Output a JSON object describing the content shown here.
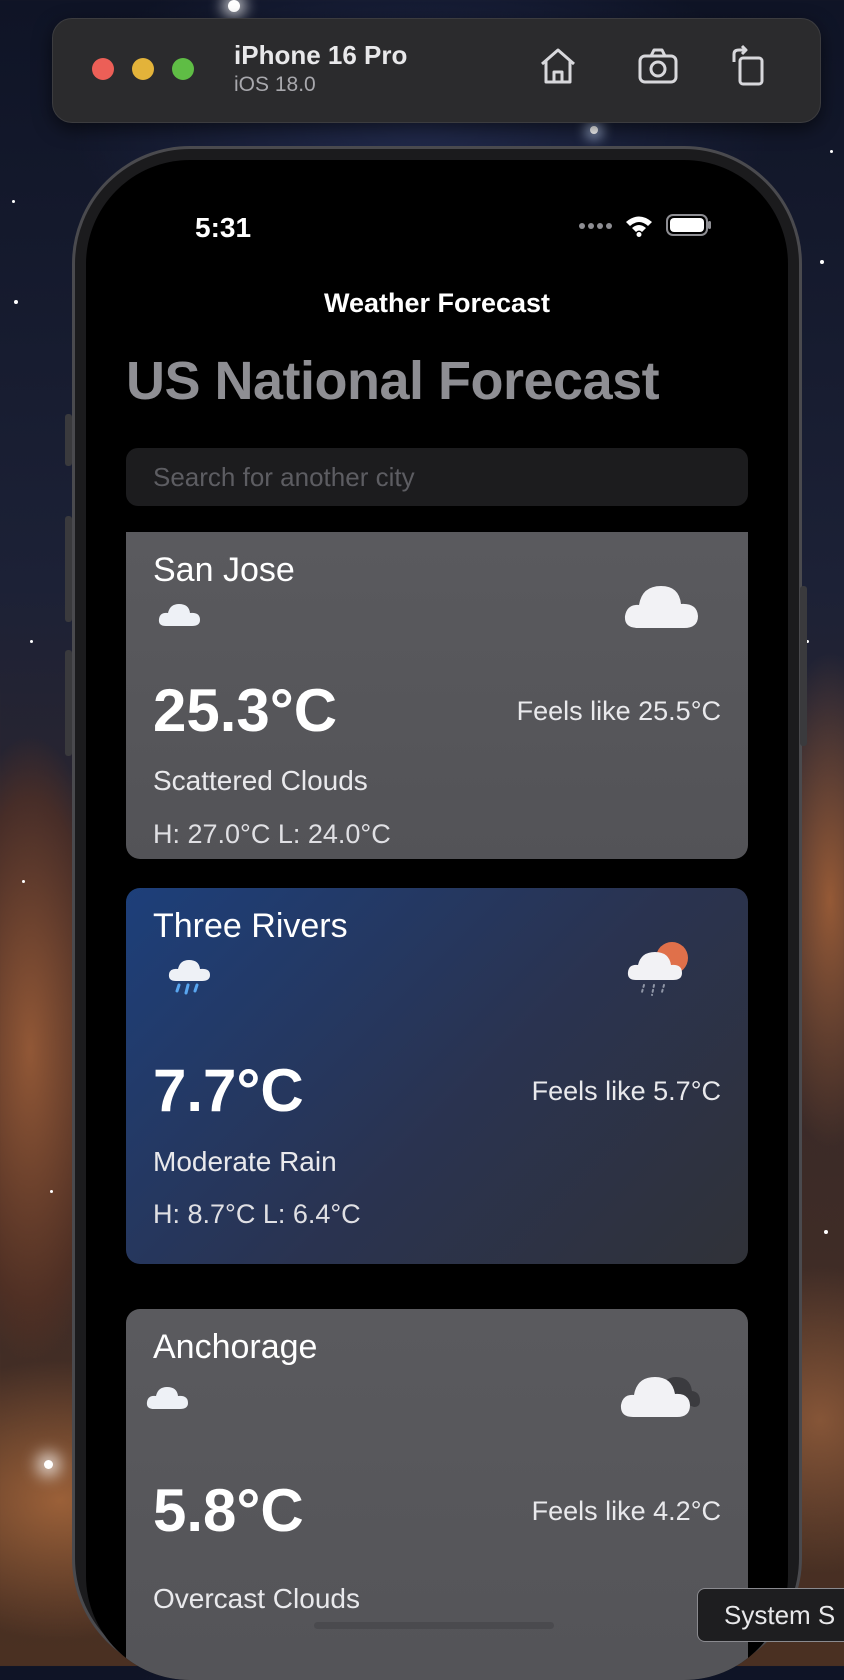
{
  "simulator": {
    "device_name": "iPhone 16 Pro",
    "os_version": "iOS 18.0",
    "buttons": [
      "home-icon",
      "screenshot-icon",
      "rotate-icon"
    ]
  },
  "status_bar": {
    "time": "5:31"
  },
  "app": {
    "nav_title": "Weather Forecast",
    "large_title": "US National Forecast",
    "search_placeholder": "Search for another city"
  },
  "cities": [
    {
      "name": "San Jose",
      "temperature": "25.3°C",
      "feels_like": "Feels like 25.5°C",
      "description": "Scattered Clouds",
      "high_low": "H: 27.0°C  L: 24.0°C",
      "condition_icon": "cloud-icon",
      "theme": "gray"
    },
    {
      "name": "Three Rivers",
      "temperature": "7.7°C",
      "feels_like": "Feels like 5.7°C",
      "description": "Moderate Rain",
      "high_low": "H: 8.7°C  L: 6.4°C",
      "condition_icon": "rain-sun-icon",
      "theme": "blue"
    },
    {
      "name": "Anchorage",
      "temperature": "5.8°C",
      "feels_like": "Feels like 4.2°C",
      "description": "Overcast Clouds",
      "condition_icon": "overcast-cloud-icon",
      "theme": "gray"
    }
  ],
  "tooltip": "System S"
}
